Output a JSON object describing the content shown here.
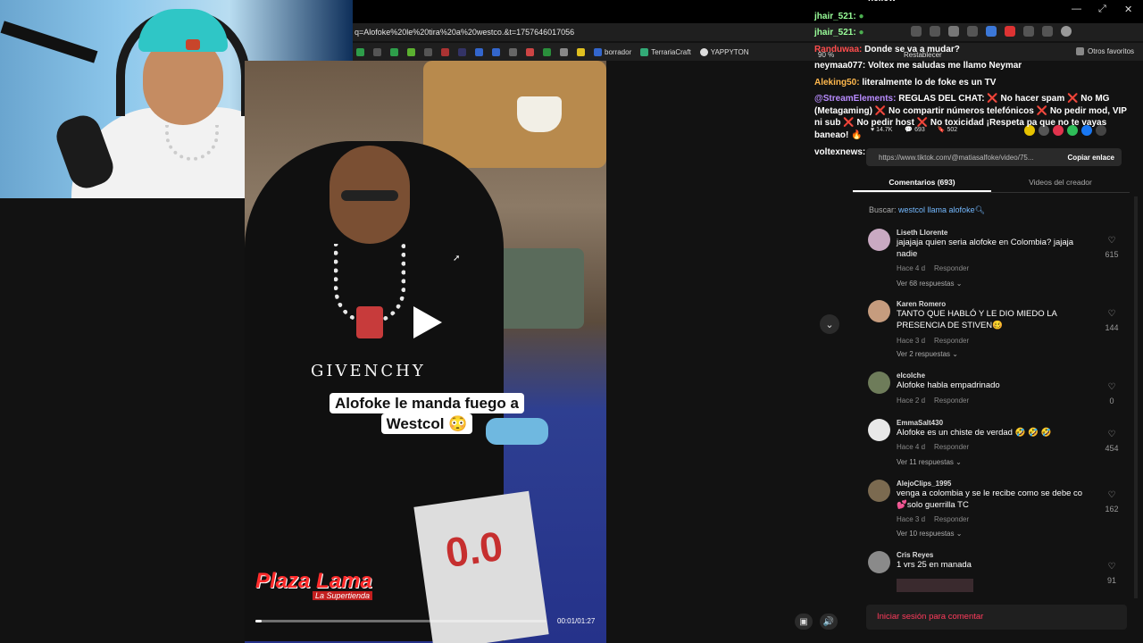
{
  "browser": {
    "url": "q=Alofoke%20le%20tira%20a%20westco.&t=1757646017056",
    "zoom": "90 %",
    "reset_label": "Restablecer",
    "bookmarks": [
      "borrador",
      "TerrariaCraft",
      "YAPPYTON"
    ],
    "other_favorites": "Otros favoritos"
  },
  "chat": {
    "lines": [
      {
        "user": "jhair_521:",
        "text": "",
        "color": "green"
      },
      {
        "user": "jhair_521:",
        "text": "",
        "color": "green"
      },
      {
        "user": "Randuwaa:",
        "text": "Donde se va a mudar?",
        "color": "red"
      },
      {
        "user": "neymaa077:",
        "text": "Voltex me saludas me llamo Neymar",
        "color": "white"
      },
      {
        "user": "Aleking50:",
        "text": "literalmente lo de foke es un TV",
        "color": "orange"
      }
    ],
    "top_partial": "hellow",
    "rules_user": "@StreamElements:",
    "rules_text": "REGLAS DEL CHAT: ❌ No hacer spam ❌ No MG (Metagaming) ❌ No compartir números telefónicos ❌ No pedir mod, VIP ni sub ❌ No pedir host ❌ No toxicidad ¡Respeta pa que no te vayas baneao! 🔥",
    "last_user": "voltexnews:"
  },
  "video": {
    "caption_line1": "Alofoke le manda fuego a",
    "caption_line2": "Westcol 😳",
    "brand": "Plaza Lama",
    "brand_sub": "La Supertienda",
    "shirt_logo": "GIVENCHY",
    "paper_text": "0.0",
    "time": "00:01/01:27",
    "progress": 0.02
  },
  "stats": {
    "likes": "14.7K",
    "comments": "693",
    "saves": "502"
  },
  "link": {
    "url": "https://www.tiktok.com/@matiasalfoke/video/75...",
    "copy_label": "Copiar enlace"
  },
  "tabs": {
    "comments": "Comentarios (693)",
    "creator_videos": "Videos del creador"
  },
  "search": {
    "label": "Buscar:",
    "term": "westcol llama alofoke"
  },
  "comments": [
    {
      "user": "Liseth Llorente",
      "text": "jajajaja quien seria alofoke en Colombia? jajaja nadie",
      "time": "Hace 4 d",
      "reply": "Responder",
      "replies": "Ver 68 respuestas",
      "likes": "615",
      "avatar": "#c9a9c2"
    },
    {
      "user": "Karen Romero",
      "text": "TANTO QUE HABLÓ Y LE DIO MIEDO LA PRESENCIA DE STIVEN🥴",
      "time": "Hace 3 d",
      "reply": "Responder",
      "replies": "Ver 2 respuestas",
      "likes": "144",
      "avatar": "#c69c7e"
    },
    {
      "user": "elcolche",
      "text": "Alofoke habla empadrinado",
      "time": "Hace 2 d",
      "reply": "Responder",
      "replies": "",
      "likes": "0",
      "avatar": "#6e7c5a"
    },
    {
      "user": "EmmaSalt430",
      "text": "Alofoke es un chiste de verdad 🤣 🤣 🤣",
      "time": "Hace 4 d",
      "reply": "Responder",
      "replies": "Ver 11 respuestas",
      "likes": "454",
      "avatar": "#e8e8e8"
    },
    {
      "user": "AlejoClips_1995",
      "text": "venga a colombia y se le recibe como se debe co 💕solo guerrilla TC",
      "time": "Hace 3 d",
      "reply": "Responder",
      "replies": "Ver 10 respuestas",
      "likes": "162",
      "avatar": "#7b6a50"
    },
    {
      "user": "Cris Reyes",
      "text": "1 vrs 25 en manada",
      "time": "",
      "reply": "",
      "replies": "",
      "likes": "91",
      "avatar": "#8a8a8a"
    }
  ],
  "comment_input_placeholder": "Iniciar sesión para comentar"
}
